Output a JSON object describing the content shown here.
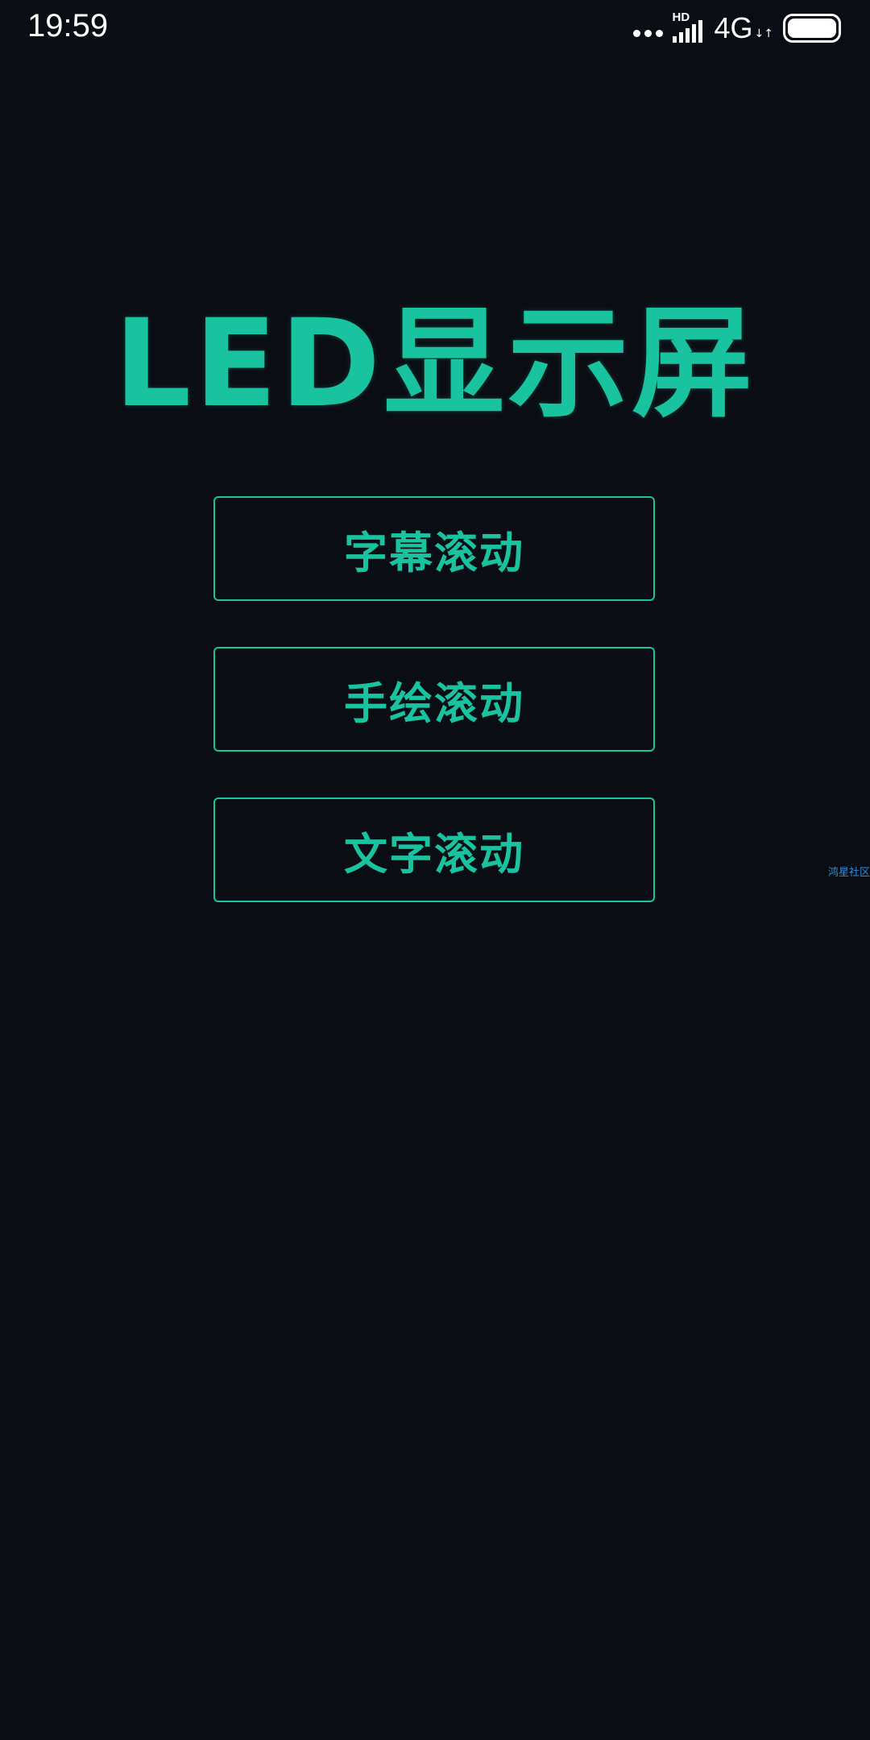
{
  "status_bar": {
    "time": "19:59",
    "hd_label": "HD",
    "network": "4G",
    "network_arrows": "↓↑"
  },
  "app": {
    "title": "LED显示屏"
  },
  "buttons": [
    {
      "label": "字幕滚动"
    },
    {
      "label": "手绘滚动"
    },
    {
      "label": "文字滚动"
    }
  ],
  "watermark": "鸿星社区",
  "colors": {
    "background": "#0a0e14",
    "accent": "#19c3a0",
    "watermark": "#2a8de0"
  }
}
